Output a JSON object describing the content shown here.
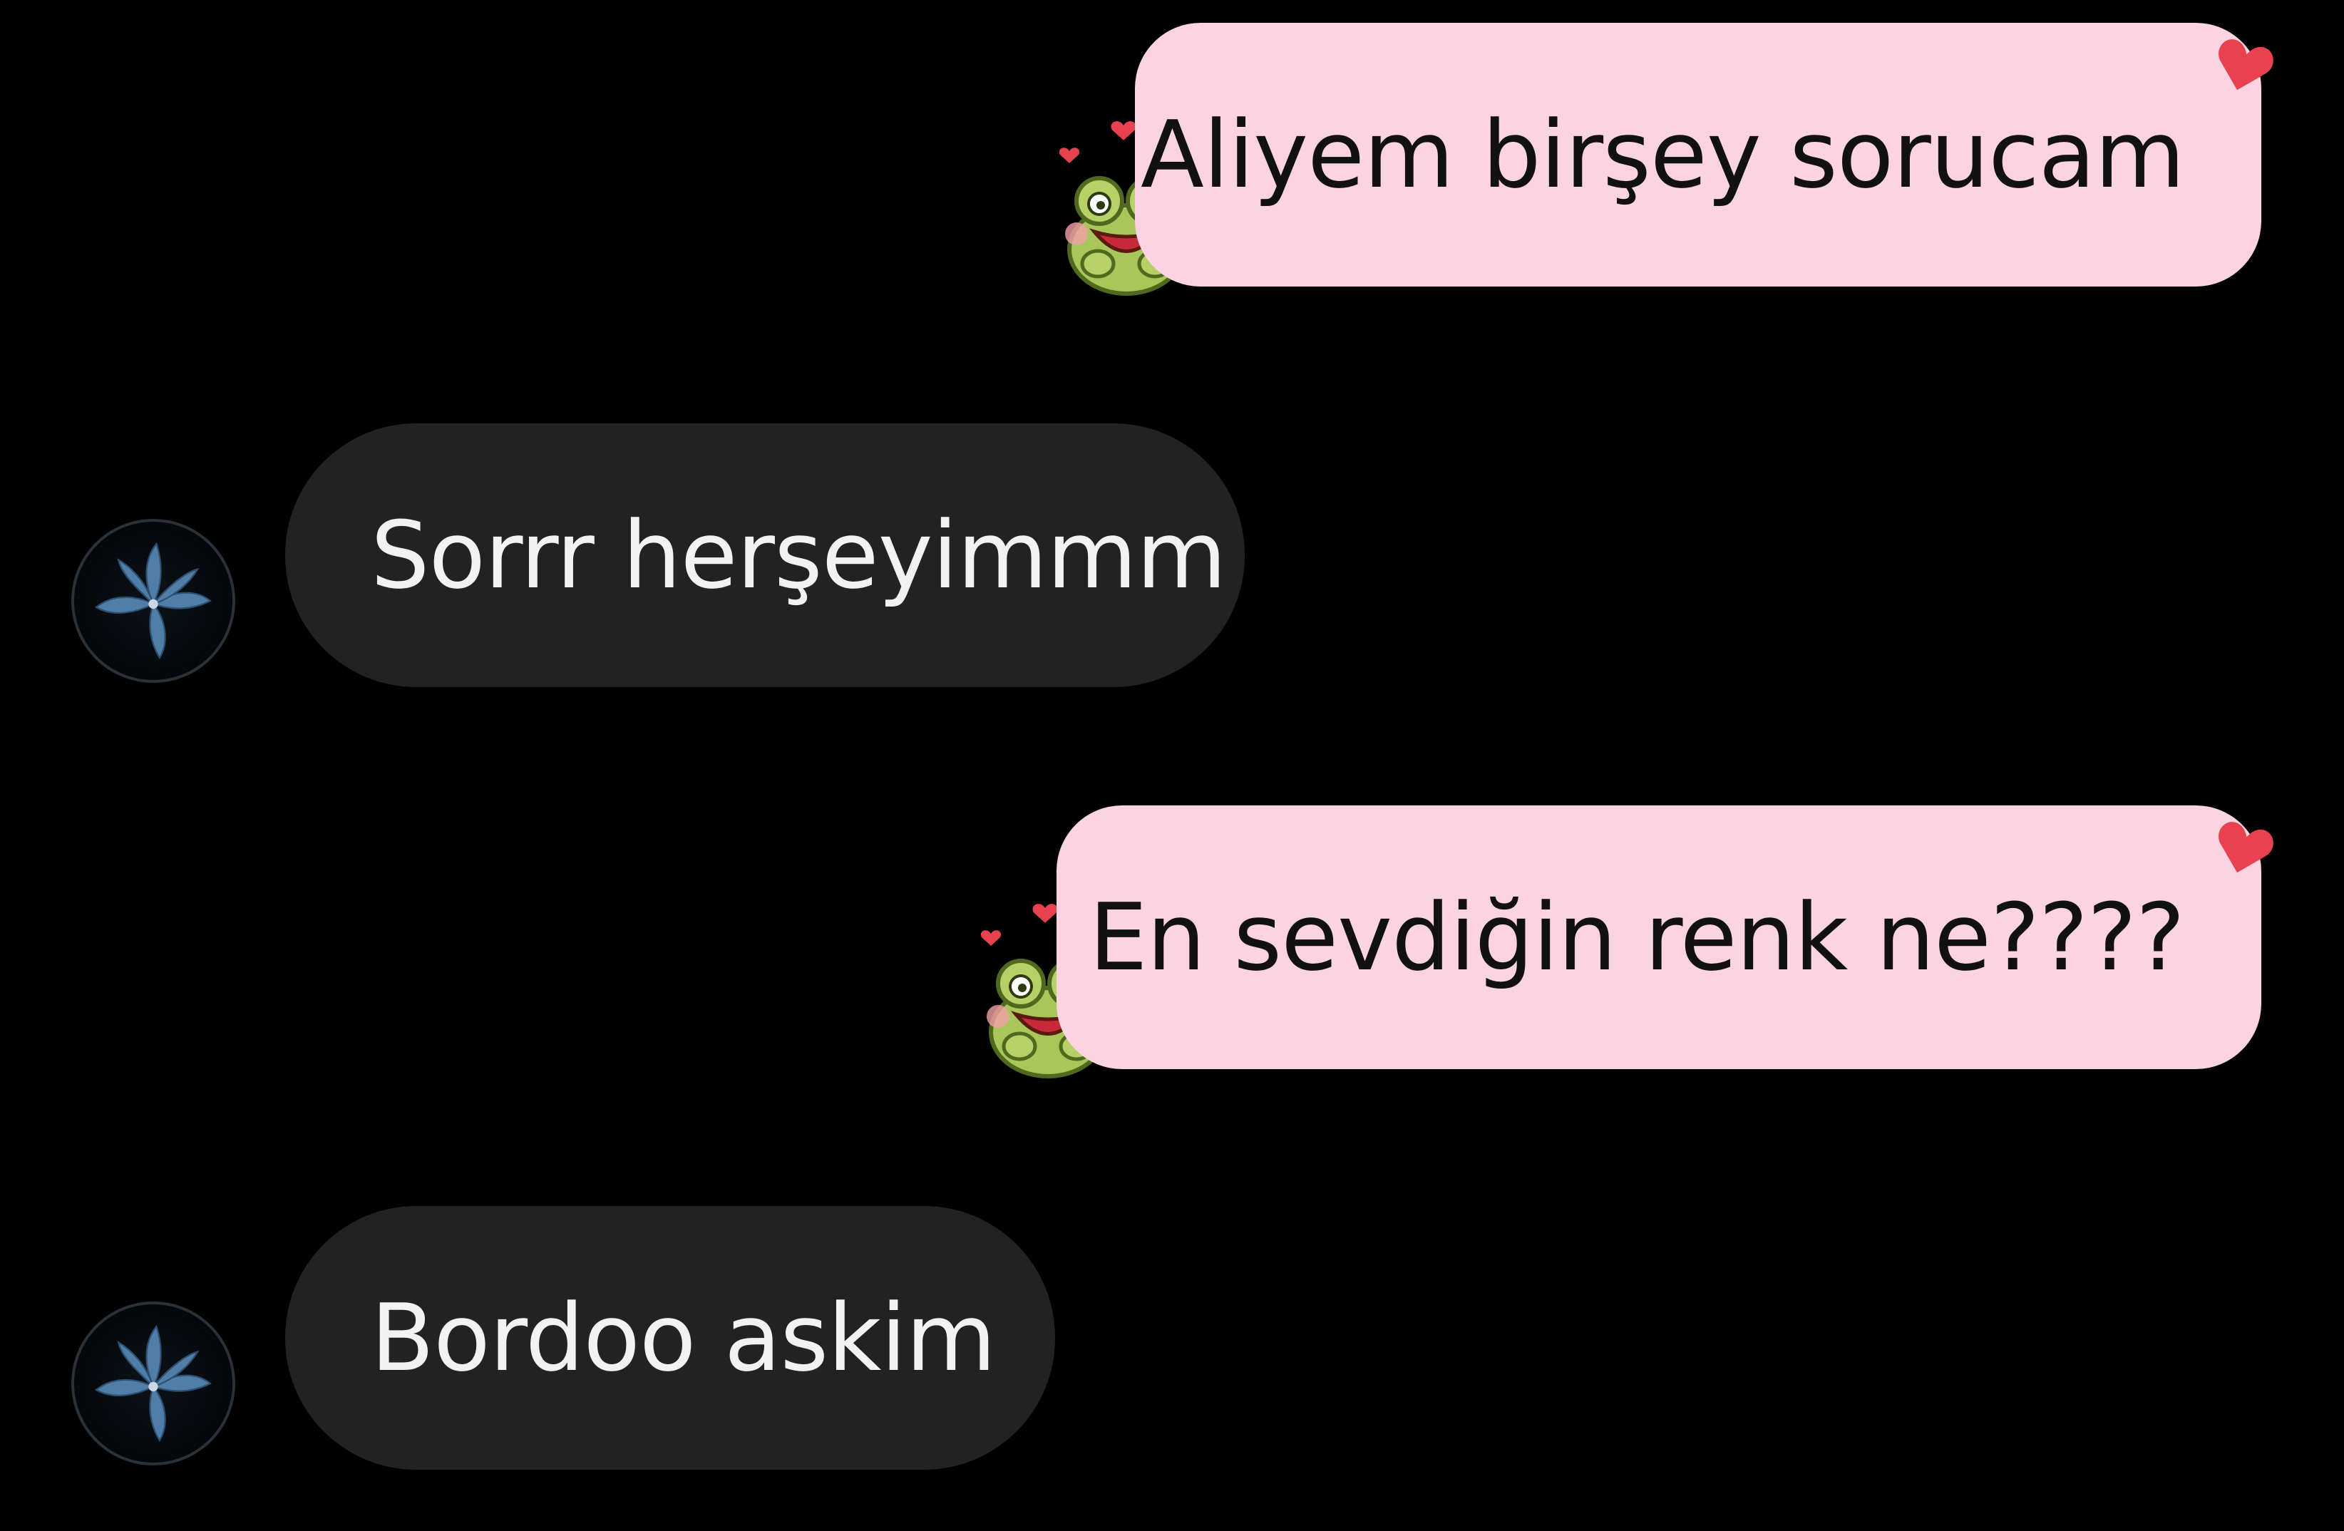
{
  "conversation": {
    "messages": [
      {
        "direction": "outgoing",
        "text": "Aliyem birşey sorucam"
      },
      {
        "direction": "incoming",
        "text": "Sorrr herşeyimmm"
      },
      {
        "direction": "outgoing",
        "text": "En sevdiğin renk ne????"
      },
      {
        "direction": "incoming",
        "text": "Bordoo askim"
      }
    ]
  },
  "theme": {
    "background": "#000000",
    "outgoing_bubble": "#fbd3e1",
    "incoming_bubble": "#222222",
    "heart": "#e8414f"
  },
  "icons": {
    "avatar": "lily-flower-avatar-icon",
    "sticker": "frog-love-sticker-icon",
    "corner": "heart-icon"
  }
}
